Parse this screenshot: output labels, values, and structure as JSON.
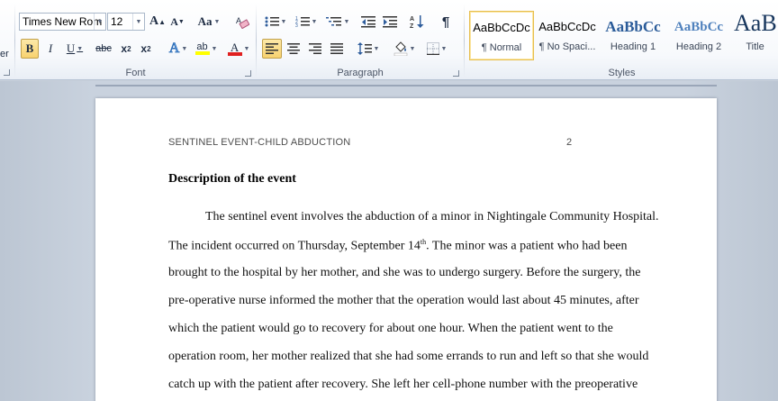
{
  "ribbon": {
    "clipped_left_text": "er",
    "font": {
      "label": "Font",
      "font_name": "Times New Rom",
      "font_size": "12",
      "grow_label": "A",
      "shrink_label": "A",
      "change_case_label": "Aa",
      "bold": "B",
      "italic": "I",
      "underline": "U",
      "strike": "abc",
      "subscript": "x",
      "subscript_sub": "2",
      "superscript": "x",
      "superscript_sup": "2",
      "highlight_label": "ab",
      "font_color_label": "A",
      "highlight_color": "#ffff00",
      "font_color": "#e02020"
    },
    "paragraph": {
      "label": "Paragraph"
    },
    "styles": {
      "label": "Styles",
      "items": [
        {
          "sample": "AaBbCcDc",
          "name": "¶ Normal"
        },
        {
          "sample": "AaBbCcDc",
          "name": "¶ No Spaci..."
        },
        {
          "sample": "AaBbCc",
          "name": "Heading 1"
        },
        {
          "sample": "AaBbCc",
          "name": "Heading 2"
        },
        {
          "sample": "AaB",
          "name": "Title"
        }
      ],
      "heading_color": "#2a5b99"
    }
  },
  "document": {
    "header_text": "SENTINEL EVENT-CHILD ABDUCTION",
    "page_number": "2",
    "heading": "Description of the event",
    "lines": [
      "The sentinel event involves the abduction of a minor in Nightingale Community Hospital.",
      "The incident occurred on Thursday, September 14",
      "brought to the hospital by her mother, and she was to undergo surgery. Before the surgery, the",
      "pre-operative nurse informed the mother that the operation would last about 45 minutes, after",
      "which the patient would go to recovery for about one hour. When the patient went to the",
      "operation room, her mother realized that she had some errands to run and left so that she would",
      "catch up with the patient after recovery. She left her cell-phone number with the preoperative"
    ],
    "line2_sup": "th",
    "line2_rest": ".  The minor was a patient who had been"
  }
}
